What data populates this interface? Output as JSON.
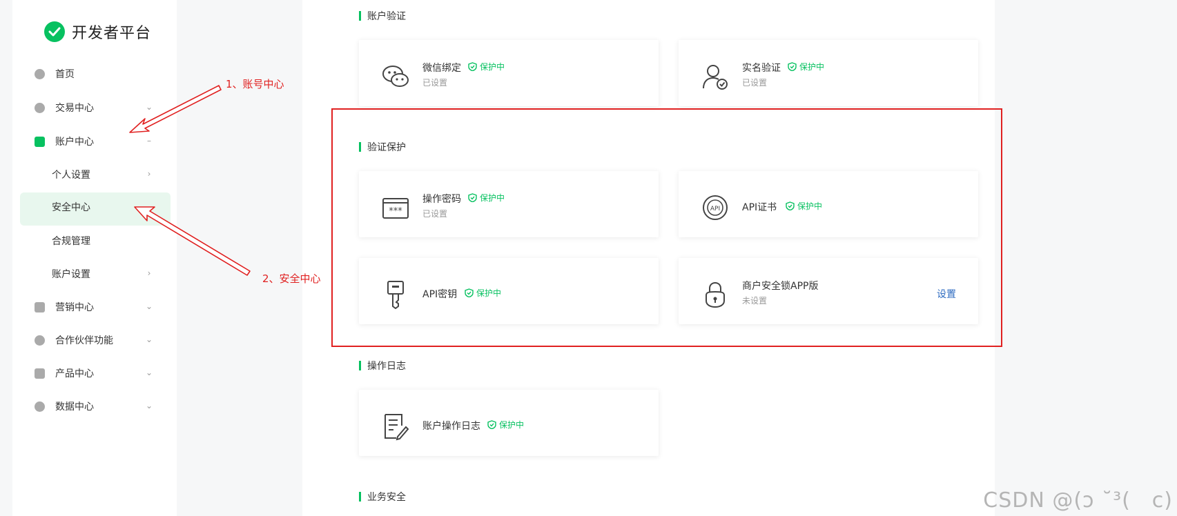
{
  "app": {
    "title": "开发者平台"
  },
  "sidebar": {
    "items": [
      {
        "label": "首页"
      },
      {
        "label": "交易中心"
      },
      {
        "label": "账户中心"
      },
      {
        "label": "个人设置"
      },
      {
        "label": "安全中心"
      },
      {
        "label": "合规管理"
      },
      {
        "label": "账户设置"
      },
      {
        "label": "营销中心"
      },
      {
        "label": "合作伙伴功能"
      },
      {
        "label": "产品中心"
      },
      {
        "label": "数据中心"
      }
    ]
  },
  "sections": {
    "account_verify": "账户验证",
    "verify_protect": "验证保护",
    "operation_log": "操作日志",
    "business_security": "业务安全"
  },
  "cards": {
    "wechat_bind": {
      "title": "微信绑定",
      "status": "保护中",
      "sub": "已设置"
    },
    "real_name": {
      "title": "实名验证",
      "status": "保护中",
      "sub": "已设置"
    },
    "op_password": {
      "title": "操作密码",
      "status": "保护中",
      "sub": "已设置"
    },
    "api_cert": {
      "title": "API证书",
      "status": "保护中"
    },
    "api_key": {
      "title": "API密钥",
      "status": "保护中"
    },
    "merchant_lock": {
      "title": "商户安全锁APP版",
      "sub": "未设置",
      "action": "设置"
    },
    "account_log": {
      "title": "账户操作日志",
      "status": "保护中"
    }
  },
  "annotations": {
    "step1": "1、账号中心",
    "step2": "2、安全中心"
  },
  "watermark": "CSDN @(ɔ ˘³(　c)",
  "colors": {
    "brand_green": "#07c160",
    "annotation_red": "#e02020",
    "link_blue": "#2d6bc0",
    "active_bg": "#e8f7ee"
  }
}
